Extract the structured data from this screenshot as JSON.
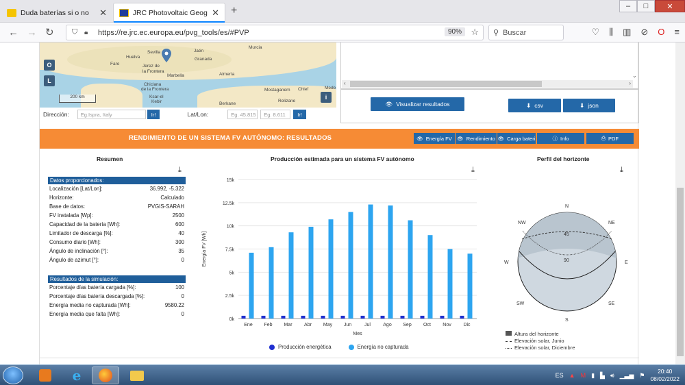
{
  "browser": {
    "tabs": [
      {
        "title": "Duda baterías si o no",
        "active": false
      },
      {
        "title": "JRC Photovoltaic Geographical",
        "active": true
      }
    ],
    "url": "https://re.jrc.ec.europa.eu/pvg_tools/es/#PVP",
    "zoom": "90%",
    "search_placeholder": "Buscar"
  },
  "map": {
    "labels": [
      "Sevilla",
      "Jaén",
      "Huelva",
      "Granada",
      "Faro",
      "Jerez de",
      "la Frontera",
      "Marbella",
      "Almería",
      "Murcia",
      "Chiclana",
      "de la Frontera",
      "Ksar-el",
      "Kebir",
      "Mostaganem",
      "Chlef",
      "Berkane",
      "Relizane",
      "Mede"
    ],
    "btn_o": "O",
    "btn_l": "L",
    "btn_i": "i",
    "scale": "200 km"
  },
  "location": {
    "direccion_label": "Dirección:",
    "direccion_placeholder": "Eg.Ispra, Italy",
    "ir_label": "Ir!",
    "latlon_label": "Lat/Lon:",
    "lat_placeholder": "Eg. 45.815",
    "lon_placeholder": "Eg. 8.611"
  },
  "buttons": {
    "visualizar": "Visualizar resultados",
    "csv": "csv",
    "json": "json"
  },
  "results_bar": {
    "title": "RENDIMIENTO DE UN SISTEMA FV AUTÓNOMO: RESULTADOS",
    "tabs": [
      "Energía FV",
      "Rendimiento",
      "Carga bateri"
    ],
    "info": "Info",
    "pdf": "PDF"
  },
  "summary": {
    "title": "Resumen",
    "provided_header": "Datos proporcionados:",
    "provided": [
      {
        "label": "Localización [Lat/Lon]:",
        "value": "36.992, -5.322"
      },
      {
        "label": "Horizonte:",
        "value": "Calculado"
      },
      {
        "label": "Base de datos:",
        "value": "PVGIS-SARAH"
      },
      {
        "label": "FV instalada [Wp]:",
        "value": "2500"
      },
      {
        "label": "Capacidad de la batería [Wh]:",
        "value": "600"
      },
      {
        "label": "Limitador de descarga [%]:",
        "value": "40"
      },
      {
        "label": "Consumo diario [Wh]:",
        "value": "300"
      },
      {
        "label": "Ángulo de inclinación [°]:",
        "value": "35"
      },
      {
        "label": "Ángulo de azimut [°]:",
        "value": "0"
      }
    ],
    "sim_header": "Resultados de la simulación:",
    "sim": [
      {
        "label": "Porcentaje días batería cargada [%]:",
        "value": "100"
      },
      {
        "label": "Porcentaje días batería descargada [%]:",
        "value": "0"
      },
      {
        "label": "Energía media no capturada [Wh]:",
        "value": "9580.22"
      },
      {
        "label": "Energía media que falta [Wh]:",
        "value": "0"
      }
    ]
  },
  "chart_data": {
    "type": "bar",
    "title": "Producción estimada para un sistema FV autónomo",
    "xlabel": "Mes",
    "ylabel": "Energía FV [Wh]",
    "ylim": [
      0,
      15000
    ],
    "yticks": [
      "0k",
      "2.5k",
      "5k",
      "7.5k",
      "10k",
      "12.5k",
      "15k"
    ],
    "categories": [
      "Ene",
      "Feb",
      "Mar",
      "Abr",
      "May",
      "Jun",
      "Jul",
      "Ago",
      "Sep",
      "Oct",
      "Nov",
      "Dic"
    ],
    "series": [
      {
        "name": "Producción energética",
        "color": "#1f2fd0",
        "values": [
          300,
          300,
          300,
          300,
          300,
          300,
          300,
          300,
          300,
          300,
          300,
          300
        ]
      },
      {
        "name": "Energía no capturada",
        "color": "#2da5f0",
        "values": [
          7100,
          7700,
          9300,
          9900,
          10700,
          11500,
          12300,
          12200,
          10600,
          9000,
          7500,
          7000
        ]
      }
    ],
    "grid": true,
    "legend": "bottom"
  },
  "horizon": {
    "title": "Perfil del horizonte",
    "directions": [
      "N",
      "NE",
      "E",
      "SE",
      "S",
      "SW",
      "W",
      "NW"
    ],
    "rings": [
      "45",
      "90"
    ],
    "legend": [
      "Altura del horizonte",
      "Elevación solar, Junio",
      "Elevación solar, Diciembre"
    ]
  },
  "taskbar": {
    "lang": "ES",
    "time": "20:40",
    "date": "08/02/2022"
  }
}
